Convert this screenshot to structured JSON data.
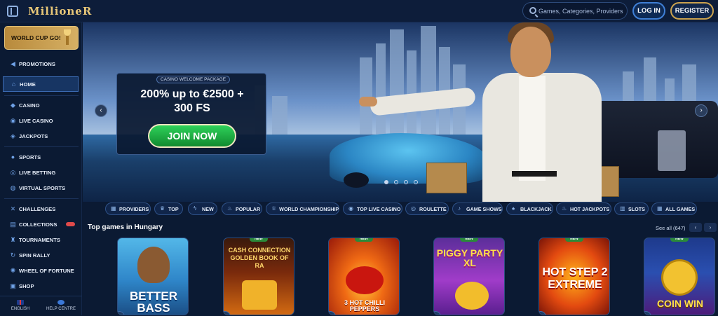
{
  "header": {
    "logo": "MillioneR",
    "search_placeholder": "Games, Categories, Providers",
    "login_label": "LOG IN",
    "register_label": "REGISTER"
  },
  "sidebar": {
    "banner_label": "WORLD CUP GO!",
    "items": [
      {
        "label": "PROMOTIONS",
        "icon": "megaphone-icon"
      },
      {
        "label": "HOME",
        "icon": "home-icon",
        "active": true
      },
      {
        "label": "CASINO",
        "icon": "diamond-icon"
      },
      {
        "label": "LIVE CASINO",
        "icon": "live-icon"
      },
      {
        "label": "JACKPOTS",
        "icon": "jackpot-icon"
      },
      {
        "label": "SPORTS",
        "icon": "ball-icon"
      },
      {
        "label": "LIVE BETTING",
        "icon": "live-betting-icon"
      },
      {
        "label": "VIRTUAL SPORTS",
        "icon": "virtual-sports-icon"
      },
      {
        "label": "CHALLENGES",
        "icon": "swords-icon"
      },
      {
        "label": "COLLECTIONS",
        "icon": "collections-icon",
        "badge": "NEW"
      },
      {
        "label": "TOURNAMENTS",
        "icon": "tournament-icon"
      },
      {
        "label": "SPIN RALLY",
        "icon": "spin-rally-icon"
      },
      {
        "label": "WHEEL OF FORTUNE",
        "icon": "wheel-icon"
      },
      {
        "label": "SHOP",
        "icon": "shop-icon"
      }
    ],
    "footer": {
      "language_label": "ENGLISH",
      "help_label": "HELP CENTRE"
    }
  },
  "hero": {
    "tag": "CASINO WELCOME PACKAGE",
    "title_line1": "200% up to €2500 +",
    "title_line2": "300 FS",
    "cta_label": "JOIN NOW",
    "slide_count": 4,
    "active_slide": 1
  },
  "filters": [
    {
      "label": "PROVIDERS",
      "icon": "providers-icon"
    },
    {
      "label": "TOP",
      "icon": "crown-icon"
    },
    {
      "label": "NEW",
      "icon": "lightning-icon"
    },
    {
      "label": "POPULAR",
      "icon": "fire-icon"
    },
    {
      "label": "WORLD CHAMPIONSHIP",
      "icon": "trophy-icon"
    },
    {
      "label": "TOP LIVE CASINO",
      "icon": "live-icon"
    },
    {
      "label": "ROULETTE",
      "icon": "roulette-icon"
    },
    {
      "label": "GAME SHOWS",
      "icon": "mic-icon"
    },
    {
      "label": "BLACKJACK",
      "icon": "cards-icon"
    },
    {
      "label": "HOT JACKPOTS",
      "icon": "flame-icon"
    },
    {
      "label": "SLOTS",
      "icon": "slots-icon"
    },
    {
      "label": "ALL GAMES",
      "icon": "grid-icon"
    }
  ],
  "top_games": {
    "title": "Top games in Hungary",
    "see_all": "See all (647)",
    "games": [
      {
        "name": "BETTER BASS",
        "new": false
      },
      {
        "name": "CASH CONNECTION GOLDEN BOOK OF RA",
        "new": true
      },
      {
        "name": "3 HOT CHILLI PEPPERS",
        "new": true
      },
      {
        "name": "PIGGY PARTY XL",
        "new": true
      },
      {
        "name": "HOT STEP 2 EXTREME",
        "new": true
      },
      {
        "name": "COIN WIN",
        "new": true
      }
    ]
  },
  "colors": {
    "accent": "#3f7fd6",
    "gold": "#caa24e",
    "cta_green": "#1fb347"
  }
}
